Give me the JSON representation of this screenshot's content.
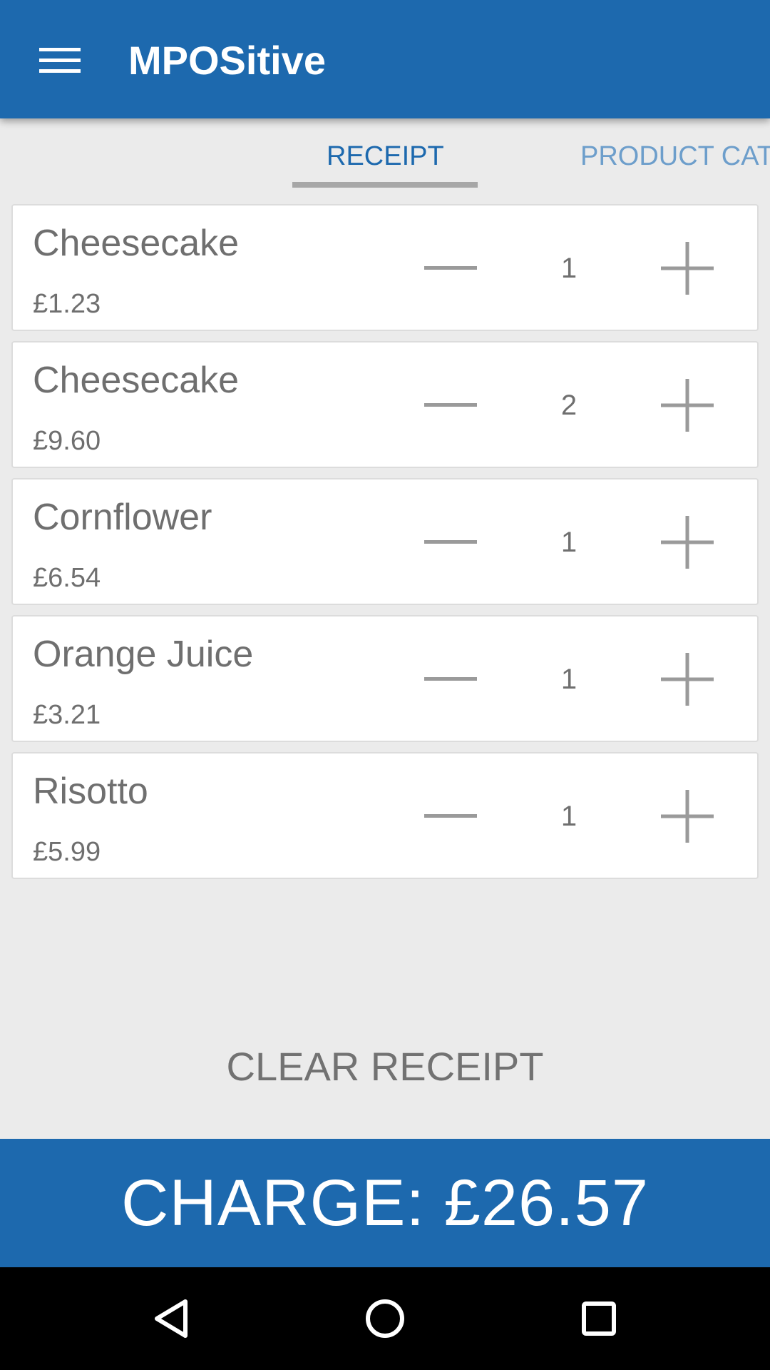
{
  "app": {
    "title": "MPOSitive",
    "colors": {
      "primary": "#1d69ae",
      "background": "#ebebeb"
    }
  },
  "tabs": [
    {
      "label": "RECEIPT",
      "selected": true
    },
    {
      "label": "PRODUCT CAT",
      "selected": false
    }
  ],
  "receipt": {
    "items": [
      {
        "name": "Cheesecake",
        "price": "£1.23",
        "quantity": "1"
      },
      {
        "name": "Cheesecake",
        "price": "£9.60",
        "quantity": "2"
      },
      {
        "name": "Cornflower",
        "price": "£6.54",
        "quantity": "1"
      },
      {
        "name": "Orange Juice",
        "price": "£3.21",
        "quantity": "1"
      },
      {
        "name": "Risotto",
        "price": "£5.99",
        "quantity": "1"
      }
    ],
    "clear_label": "CLEAR RECEIPT"
  },
  "charge": {
    "label": "CHARGE: £26.57"
  },
  "icons": {
    "menu": "hamburger-menu-icon",
    "decrease": "minus-icon",
    "increase": "plus-icon",
    "nav": [
      "back-triangle-icon",
      "home-circle-icon",
      "recents-square-icon"
    ]
  }
}
